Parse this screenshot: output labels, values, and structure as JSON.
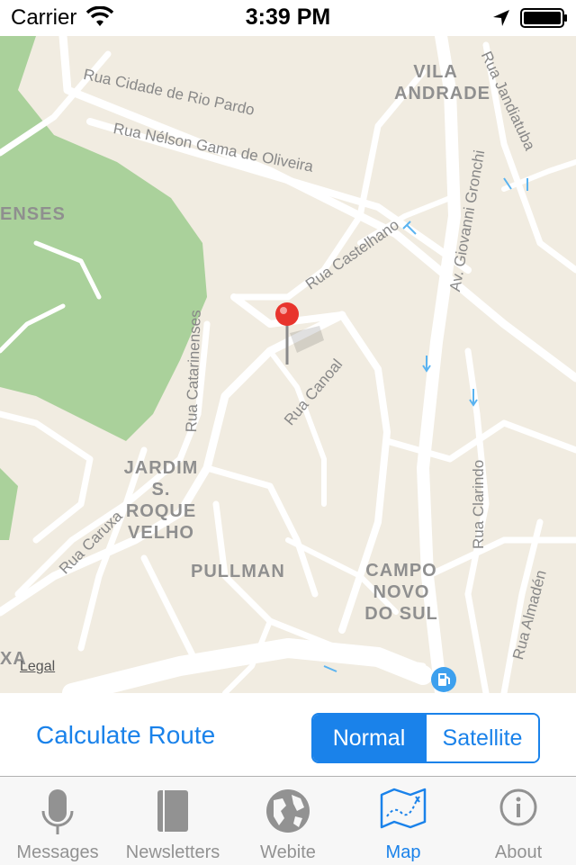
{
  "status_bar": {
    "carrier": "Carrier",
    "time": "3:39 PM"
  },
  "map": {
    "streets": [
      "Rua Cidade de Rio Pardo",
      "Rua Nélson Gama de Oliveira",
      "Rua Castelhano",
      "Av. Giovanni Gronchi",
      "Rua Jandiatuba",
      "Rua Catarinenses",
      "Rua Canoal",
      "Rua Caruxa",
      "Rua Clarindo",
      "Rua Almadén"
    ],
    "districts": {
      "vila_andrade": "VILA ANDRADE",
      "enses": "ENSES",
      "jardim": "JARDIM S. ROQUE VELHO",
      "pullman": "PULLMAN",
      "campo": "CAMPO NOVO DO SUL",
      "xa": "XA"
    },
    "legal": "Legal",
    "pin_icon": "red-map-pin",
    "poi_icon": "gas-station"
  },
  "controls": {
    "calculate_route": "Calculate Route",
    "segments": [
      "Normal",
      "Satellite"
    ],
    "selected": "Normal"
  },
  "tabs": [
    {
      "label": "Messages",
      "icon": "microphone-icon"
    },
    {
      "label": "Newsletters",
      "icon": "book-icon"
    },
    {
      "label": "Webite",
      "icon": "globe-icon"
    },
    {
      "label": "Map",
      "icon": "map-icon",
      "active": true
    },
    {
      "label": "About",
      "icon": "info-icon"
    }
  ],
  "colors": {
    "accent": "#1a82ea",
    "map_bg": "#f1ece1",
    "park": "#aad19b",
    "pin": "#e8342c"
  }
}
